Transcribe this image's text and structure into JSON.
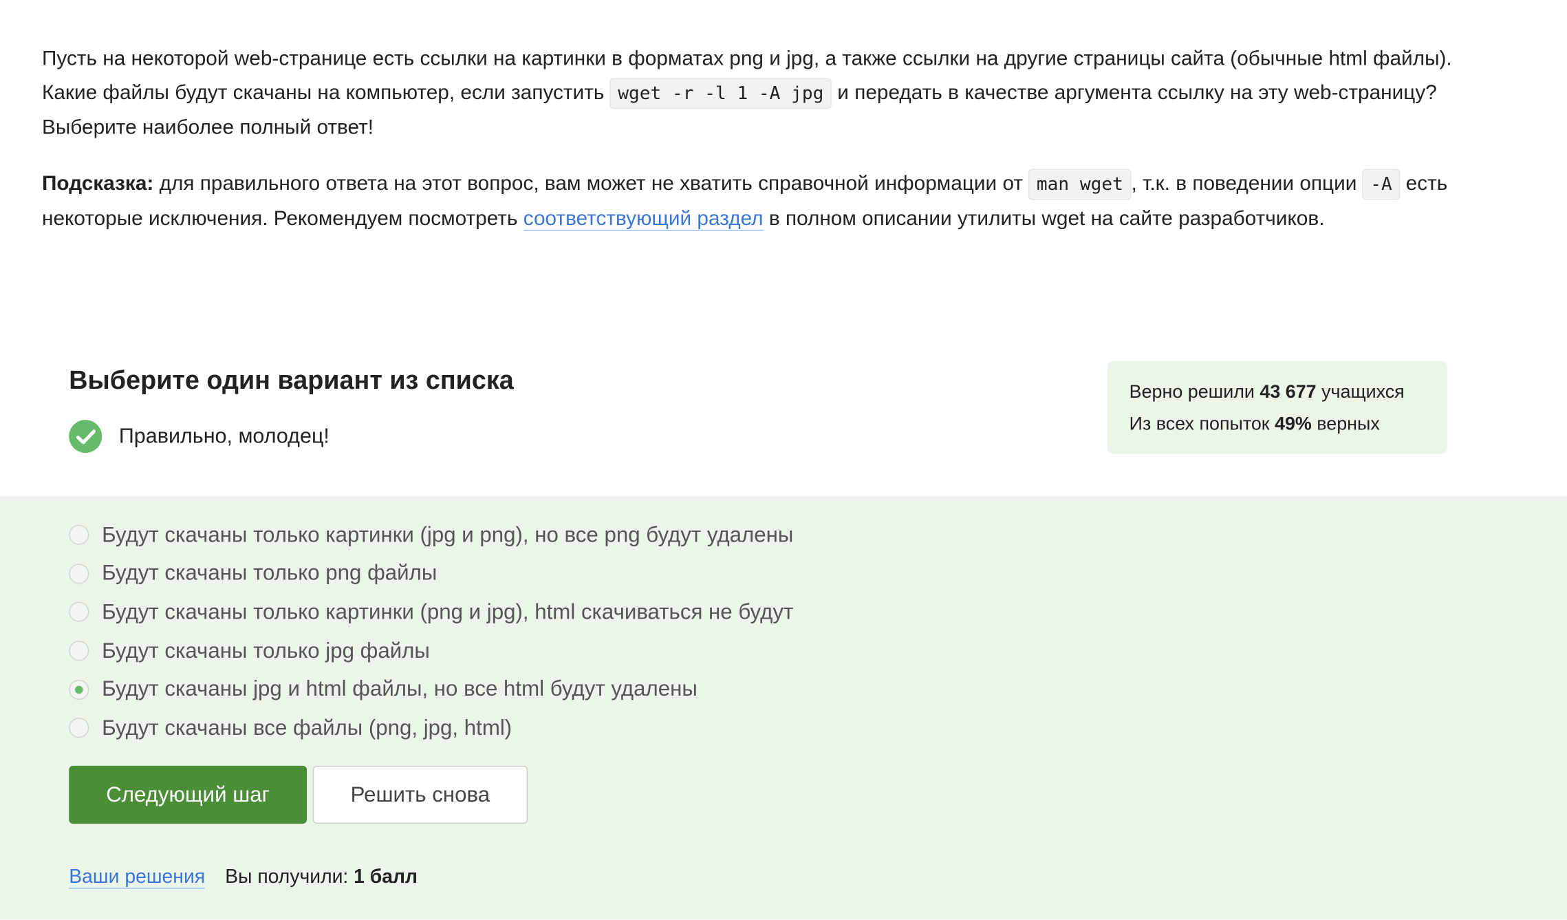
{
  "question": {
    "p1": {
      "text_before": "Пусть на некоторой web-странице есть ссылки на картинки в форматах png и jpg, а также ссылки на другие страницы сайта (обычные html файлы). Какие файлы будут скачаны на компьютер, если запустить ",
      "code": "wget -r -l 1 -A jpg",
      "text_after": " и передать в качестве аргумента ссылку на эту web-страницу? Выберите наиболее полный ответ!"
    },
    "p2": {
      "hint_label": "Подсказка:",
      "text1": " для правильного ответа на этот вопрос, вам может не хватить справочной информации от ",
      "code1": "man wget",
      "text2": ", т.к. в поведении опции ",
      "code2": "-A",
      "text3": " есть некоторые исключения. Рекомендуем посмотреть ",
      "link": "соответствующий раздел",
      "text4": " в полном описании утилиты wget на сайте разработчиков."
    }
  },
  "quiz": {
    "title": "Выберите один вариант из списка",
    "feedback": "Правильно, молодец!",
    "stats": {
      "solved_prefix": "Верно решили ",
      "solved_count": "43 677",
      "solved_suffix": " учащихся",
      "attempts_prefix": "Из всех попыток ",
      "attempts_percent": "49%",
      "attempts_suffix": " верных"
    },
    "options": [
      {
        "label": "Будут скачаны только картинки (jpg и png), но все png будут удалены",
        "selected": false
      },
      {
        "label": "Будут скачаны только png файлы",
        "selected": false
      },
      {
        "label": "Будут скачаны только картинки (png и jpg), html скачиваться не будут",
        "selected": false
      },
      {
        "label": "Будут скачаны только jpg файлы",
        "selected": false
      },
      {
        "label": "Будут скачаны jpg и html файлы, но все html будут удалены",
        "selected": true
      },
      {
        "label": "Будут скачаны все файлы (png, jpg, html)",
        "selected": false
      }
    ],
    "next_button": "Следующий шаг",
    "retry_button": "Решить снова",
    "footer": {
      "solutions_link": "Ваши решения",
      "score_prefix": "Вы получили: ",
      "score_value": "1 балл"
    }
  },
  "colors": {
    "accent_green": "#4a8e37",
    "check_green": "#66bb6a",
    "answer_bg": "#ecf5ea",
    "stats_bg": "#ebf5e8",
    "link_blue": "#3a76d8"
  },
  "icons": {
    "feedback": "check-circle-icon",
    "option": "radio-icon"
  }
}
